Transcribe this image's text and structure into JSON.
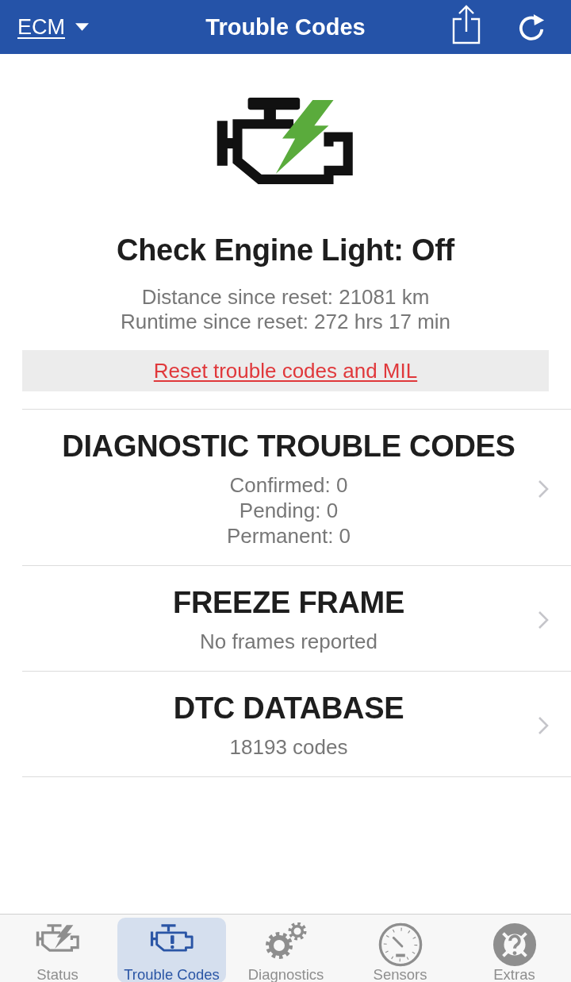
{
  "nav_bar": {
    "module": "ECM",
    "title": "Trouble Codes"
  },
  "status": {
    "title": "Check Engine Light: Off",
    "details": [
      "Distance since reset: 21081 km",
      "Runtime since reset: 272 hrs 17 min"
    ],
    "reset_label": "Reset trouble codes and MIL"
  },
  "sections": [
    {
      "title": "DIAGNOSTIC TROUBLE CODES",
      "lines": [
        "Confirmed: 0",
        "Pending: 0",
        "Permanent: 0"
      ]
    },
    {
      "title": "FREEZE FRAME",
      "lines": [
        "No frames reported"
      ]
    },
    {
      "title": "DTC DATABASE",
      "lines": [
        "18193 codes"
      ]
    }
  ],
  "tabs": [
    {
      "label": "Status",
      "kind": "status",
      "selected": false
    },
    {
      "label": "Trouble Codes",
      "kind": "codes",
      "selected": true
    },
    {
      "label": "Diagnostics",
      "kind": "diagnostics",
      "selected": false
    },
    {
      "label": "Sensors",
      "kind": "sensors",
      "selected": false
    },
    {
      "label": "Extras",
      "kind": "extras",
      "selected": false
    }
  ]
}
